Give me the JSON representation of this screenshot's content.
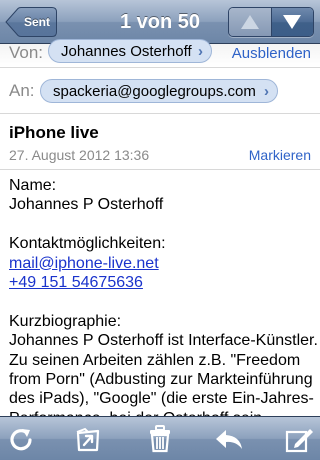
{
  "navbar": {
    "back_label": "Sent",
    "title": "1 von 50",
    "prev_icon": "arrow-up-icon",
    "next_icon": "arrow-down-icon"
  },
  "header": {
    "from_label": "Von:",
    "from_name": "Johannes Osterhoff",
    "hide_label": "Ausblenden",
    "to_label": "An:",
    "to_address": "spackeria@googlegroups.com"
  },
  "subject": {
    "title": "iPhone live",
    "date": "27. August 2012 13:36",
    "mark_label": "Markieren"
  },
  "body": {
    "name_heading": "Name:",
    "name_value": "Johannes P Osterhoff",
    "contact_heading": "Kontaktmöglichkeiten:",
    "email": "mail@iphone-live.net",
    "phone": "+49 151 54675636",
    "bio_heading": "Kurzbiographie:",
    "bio_lines": [
      "Johannes P Osterhoff ist Interface-Künstler.",
      "Zu seinen Arbeiten zählen z.B. \"Freedom",
      "from Porn\" (Adbusting zur Markteinführung",
      "des iPads), \"Google\" (die erste Ein-Jahres-",
      "Performance, bei der Osterhoff sein"
    ]
  },
  "toolbar": {
    "refresh_icon": "refresh-icon",
    "move_icon": "move-to-folder-icon",
    "trash_icon": "trash-icon",
    "reply_icon": "reply-icon",
    "compose_icon": "compose-icon"
  },
  "colors": {
    "bar_blue": "#7a91b0",
    "link_blue": "#2f63c8",
    "bubble_bg": "#d4e1f3"
  }
}
